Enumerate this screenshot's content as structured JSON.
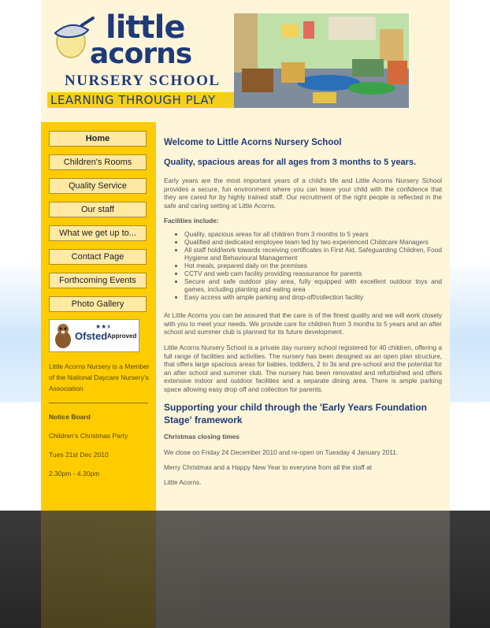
{
  "logo": {
    "line1": "little",
    "line2": "acorns",
    "line3": "NURSERY SCHOOL",
    "tagline": "LEARNING THROUGH PLAY"
  },
  "nav": [
    {
      "label": "Home"
    },
    {
      "label": "Children's Rooms"
    },
    {
      "label": "Quality Service"
    },
    {
      "label": "Our staff"
    },
    {
      "label": "What we get up to..."
    },
    {
      "label": "Contact Page"
    },
    {
      "label": "Forthcoming Events"
    },
    {
      "label": "Photo Gallery"
    }
  ],
  "ofsted": {
    "name": "Ofsted",
    "approved": "Approved"
  },
  "sidebar": {
    "membership": "Little Acorns Nursery is a Member of the National Daycare Nursery's Association",
    "notice_title": "Notice Board",
    "notice_event": "Children's Christmas Party",
    "notice_date": "Tues 21st Dec 2010",
    "notice_time": "2.30pm - 4.30pm"
  },
  "main": {
    "welcome": "Welcome to Little Acorns Nursery School",
    "subtitle": "Quality, spacious areas for all ages from 3 months to 5 years.",
    "intro": "Early years are the most important years of a child's life and Little Acorns Nursery School provides a secure, fun environment where you can leave your child with the confidence that they are cared for by highly trained staff. Our recruitment of the right people is reflected in the safe and caring setting at Little Acorns.",
    "facilities_title": "Facilities include:",
    "facilities": [
      "Quality, spacious areas for all children from 3 months to 5 years",
      "Qualified and dedicated employee team led by two experienced Childcare Managers",
      "All staff hold/work towards receiving certificates in First Aid, Safeguarding Children, Food Hygiene and Behavioural Management",
      "Hot meals, prepared daily on the premises",
      "CCTV and web cam facility providing reassurance for parents",
      "Secure and safe outdoor play area, fully equipped with excellent outdoor toys and games, including planting and eating area",
      "Easy access with ample parking and drop-off/collection facility"
    ],
    "assurance": "At Little Acorns you can be assured that the care is of the finest quality and we will work closely with you to meet your needs. We provide care for children from 3 months to 5 years and an after school and summer club is planned for its future development.",
    "about": "Little Acorns Nursery School is a private day nursery school registered for 40 children, offering a full range of facilities and activities. The nursery has been designed as an open plan structure, that offers large spacious areas for babies, toddlers, 2 to 3s and pre-school and the potential for an after school and summer club. The nursery has been renovated and refurbished and offers extensive indoor and outdoor facilities and a separate dining area. There is ample parking space allowing easy drop off and collection for parents.",
    "eyfs_heading": "Supporting your child through the 'Early Years Foundation Stage' framework",
    "closing_title": "Christmas closing times",
    "closing_text": "We close on Friday 24 December 2010 and re-open on Tuesday 4 January 2011.",
    "greeting": "Merry Christmas and a Happy New Year to everyone from all the staff at",
    "signoff": "Little Acorns."
  },
  "colors": {
    "accent_yellow": "#ffcc00",
    "navy": "#1f3a78",
    "page_bg": "#fff6da"
  }
}
